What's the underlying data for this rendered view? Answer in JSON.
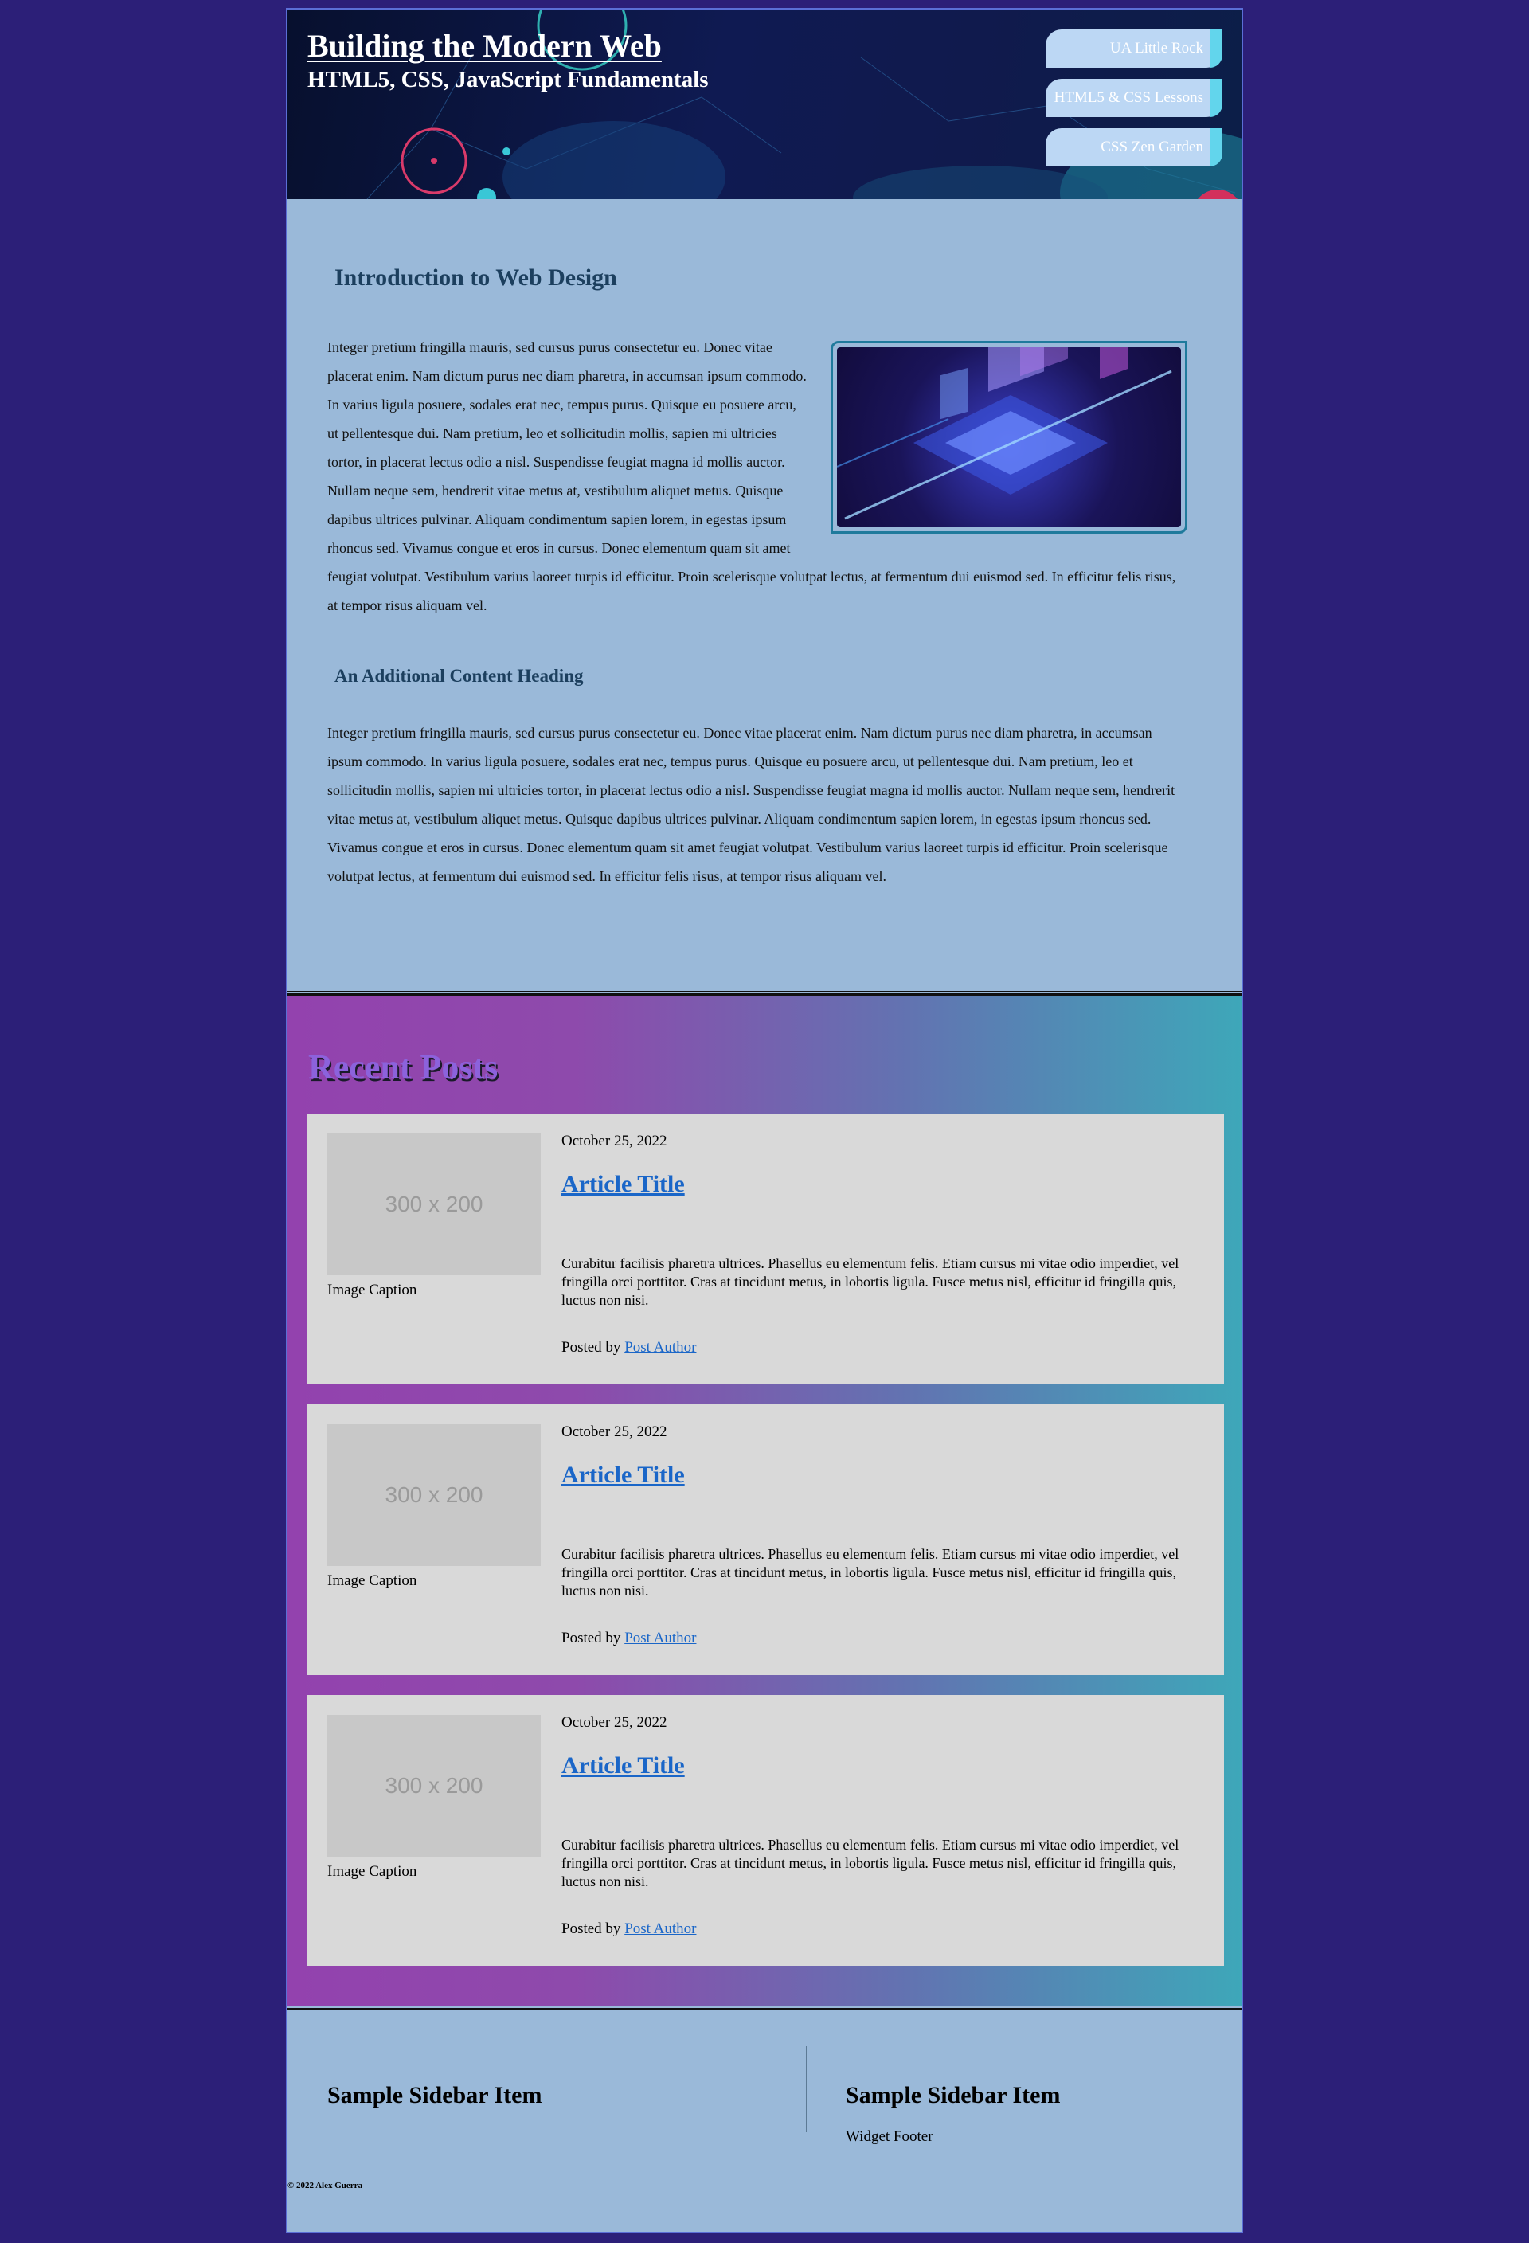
{
  "header": {
    "title": "Building the Modern Web",
    "subtitle": "HTML5, CSS, JavaScript Fundamentals",
    "nav": [
      "UA Little Rock",
      "HTML5 & CSS Lessons",
      "CSS Zen Garden"
    ]
  },
  "intro": {
    "heading": "Introduction to Web Design",
    "paragraph1": "Integer pretium fringilla mauris, sed cursus purus consectetur eu. Donec vitae placerat enim. Nam dictum purus nec diam pharetra, in accumsan ipsum commodo. In varius ligula posuere, sodales erat nec, tempus purus. Quisque eu posuere arcu, ut pellentesque dui. Nam pretium, leo et sollicitudin mollis, sapien mi ultricies tortor, in placerat lectus odio a nisl. Suspendisse feugiat magna id mollis auctor. Nullam neque sem, hendrerit vitae metus at, vestibulum aliquet metus. Quisque dapibus ultrices pulvinar. Aliquam condimentum sapien lorem, in egestas ipsum rhoncus sed. Vivamus congue et eros in cursus. Donec elementum quam sit amet feugiat volutpat. Vestibulum varius laoreet turpis id efficitur. Proin scelerisque volutpat lectus, at fermentum dui euismod sed. In efficitur felis risus, at tempor risus aliquam vel.",
    "subheading": "An Additional Content Heading",
    "paragraph2": "Integer pretium fringilla mauris, sed cursus purus consectetur eu. Donec vitae placerat enim. Nam dictum purus nec diam pharetra, in accumsan ipsum commodo. In varius ligula posuere, sodales erat nec, tempus purus. Quisque eu posuere arcu, ut pellentesque dui. Nam pretium, leo et sollicitudin mollis, sapien mi ultricies tortor, in placerat lectus odio a nisl. Suspendisse feugiat magna id mollis auctor. Nullam neque sem, hendrerit vitae metus at, vestibulum aliquet metus. Quisque dapibus ultrices pulvinar. Aliquam condimentum sapien lorem, in egestas ipsum rhoncus sed. Vivamus congue et eros in cursus. Donec elementum quam sit amet feugiat volutpat. Vestibulum varius laoreet turpis id efficitur. Proin scelerisque volutpat lectus, at fermentum dui euismod sed. In efficitur felis risus, at tempor risus aliquam vel."
  },
  "posts": {
    "heading": "Recent Posts",
    "items": [
      {
        "thumb": "300 x 200",
        "caption": "Image Caption",
        "date": "October 25, 2022",
        "title": "Article Title",
        "excerpt": "Curabitur facilisis pharetra ultrices. Phasellus eu elementum felis. Etiam cursus mi vitae odio imperdiet, vel fringilla orci porttitor. Cras at tincidunt metus, in lobortis ligula. Fusce metus nisl, efficitur id fringilla quis, luctus non nisi.",
        "posted_by": "Posted by",
        "author": "Post Author"
      },
      {
        "thumb": "300 x 200",
        "caption": "Image Caption",
        "date": "October 25, 2022",
        "title": "Article Title",
        "excerpt": "Curabitur facilisis pharetra ultrices. Phasellus eu elementum felis. Etiam cursus mi vitae odio imperdiet, vel fringilla orci porttitor. Cras at tincidunt metus, in lobortis ligula. Fusce metus nisl, efficitur id fringilla quis, luctus non nisi.",
        "posted_by": "Posted by",
        "author": "Post Author"
      },
      {
        "thumb": "300 x 200",
        "caption": "Image Caption",
        "date": "October 25, 2022",
        "title": "Article Title",
        "excerpt": "Curabitur facilisis pharetra ultrices. Phasellus eu elementum felis. Etiam cursus mi vitae odio imperdiet, vel fringilla orci porttitor. Cras at tincidunt metus, in lobortis ligula. Fusce metus nisl, efficitur id fringilla quis, luctus non nisi.",
        "posted_by": "Posted by",
        "author": "Post Author"
      }
    ]
  },
  "sidebar": {
    "widget1_title": "Sample Sidebar Item",
    "widget2_title": "Sample Sidebar Item",
    "widget2_footer": "Widget Footer"
  },
  "footer": {
    "copyright": "© 2022 Alex Guerra"
  },
  "colors": {
    "page_background": "#2c1f78",
    "content_background": "#9ab9d9",
    "heading_color": "#1c3f5e",
    "link_color": "#1a66c8",
    "nav_button": "#bcd7f4",
    "nav_accent": "#62d5ec",
    "posts_gradient_start": "#9342ae",
    "posts_gradient_end": "#3ea7b9",
    "card_background": "#d9d9d9"
  }
}
